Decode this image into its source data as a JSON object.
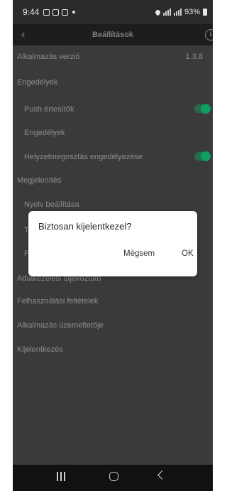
{
  "status_bar": {
    "time": "9:44",
    "battery": "93%"
  },
  "app_bar": {
    "title": "Beállítások"
  },
  "settings": {
    "app_version_label": "Alkalmazás verzió",
    "app_version_value": "1.3.8",
    "permissions_section": "Engedélyek",
    "push_label": "Push értesítők",
    "push_enabled": true,
    "permissions_item": "Engedélyek",
    "location_label": "Helyzetmegosztás engedélyezése",
    "location_enabled": true,
    "display_section": "Megjelenítés",
    "language_item": "Nyelv beállítása",
    "partial_item_1": "Té",
    "partial_item_2": "Po",
    "privacy_item": "Adatkezelési tájékoztató",
    "terms_item": "Felhasználási feltételek",
    "operator_item": "Alkalmazás üzemeltetője",
    "logout_item": "Kijelentkezés"
  },
  "dialog": {
    "message": "Biztosan kijelentkezel?",
    "cancel_label": "Mégsem",
    "ok_label": "OK"
  },
  "colors": {
    "toggle_on": "#0e9e62",
    "overlay_bg": "#3a3a3a"
  }
}
